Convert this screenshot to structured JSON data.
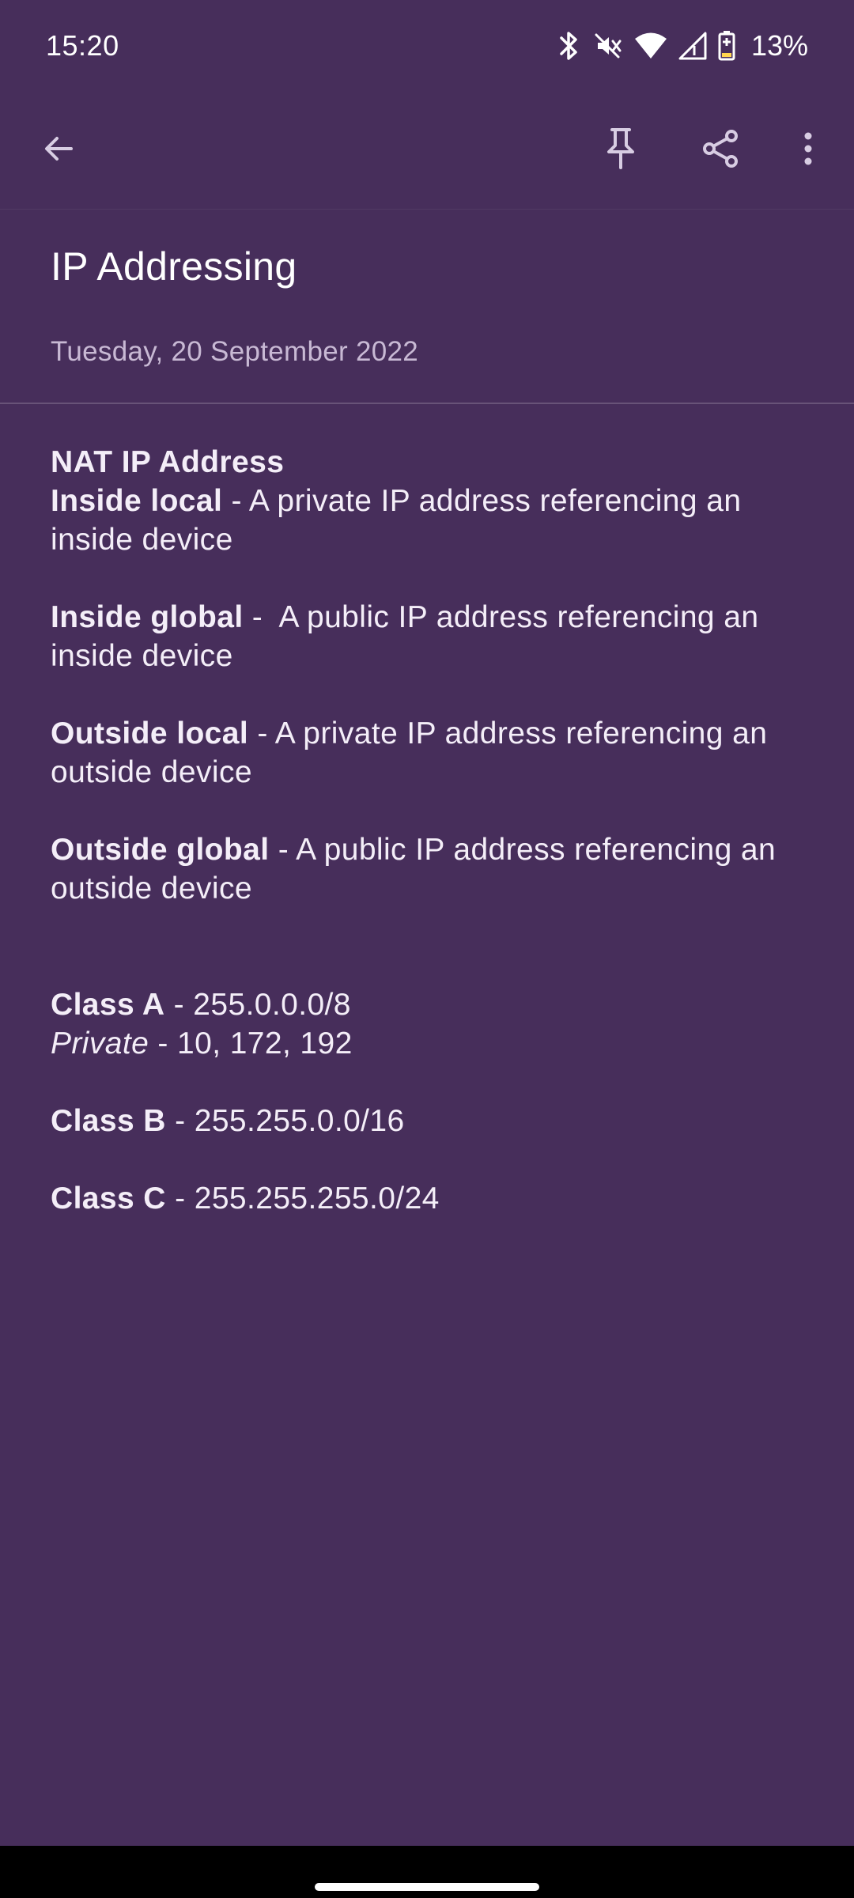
{
  "status_bar": {
    "time": "15:20",
    "battery_percent": "13%",
    "icons": [
      "bluetooth-icon",
      "vibrate-off-icon",
      "wifi-icon",
      "signal-icon",
      "battery-charging-icon"
    ]
  },
  "toolbar": {
    "back_icon": "arrow-back-icon",
    "pin_icon": "pin-icon",
    "share_icon": "share-icon",
    "more_icon": "more-vert-icon"
  },
  "note": {
    "title": "IP Addressing",
    "date": "Tuesday, 20 September 2022",
    "heading": "NAT IP Address",
    "inside_local_term": "Inside local",
    "inside_local_desc": " - A private IP address referencing an inside device",
    "inside_global_term": "Inside global",
    "inside_global_desc": " -  A public IP address referencing an inside device",
    "outside_local_term": "Outside local",
    "outside_local_desc": " - A private IP address referencing an outside device",
    "outside_global_term": "Outside global",
    "outside_global_desc": " - A public IP address referencing an outside device",
    "class_a_term": "Class A",
    "class_a_desc": " - 255.0.0.0/8",
    "private_term": "Private",
    "private_desc": " - 10, 172, 192",
    "class_b_term": "Class B",
    "class_b_desc": " - 255.255.0.0/16",
    "class_c_term": "Class C",
    "class_c_desc": " - 255.255.255.0/24"
  },
  "colors": {
    "background": "#472e5b",
    "date_text": "#c8b9d4",
    "nav_bar": "#000000"
  }
}
